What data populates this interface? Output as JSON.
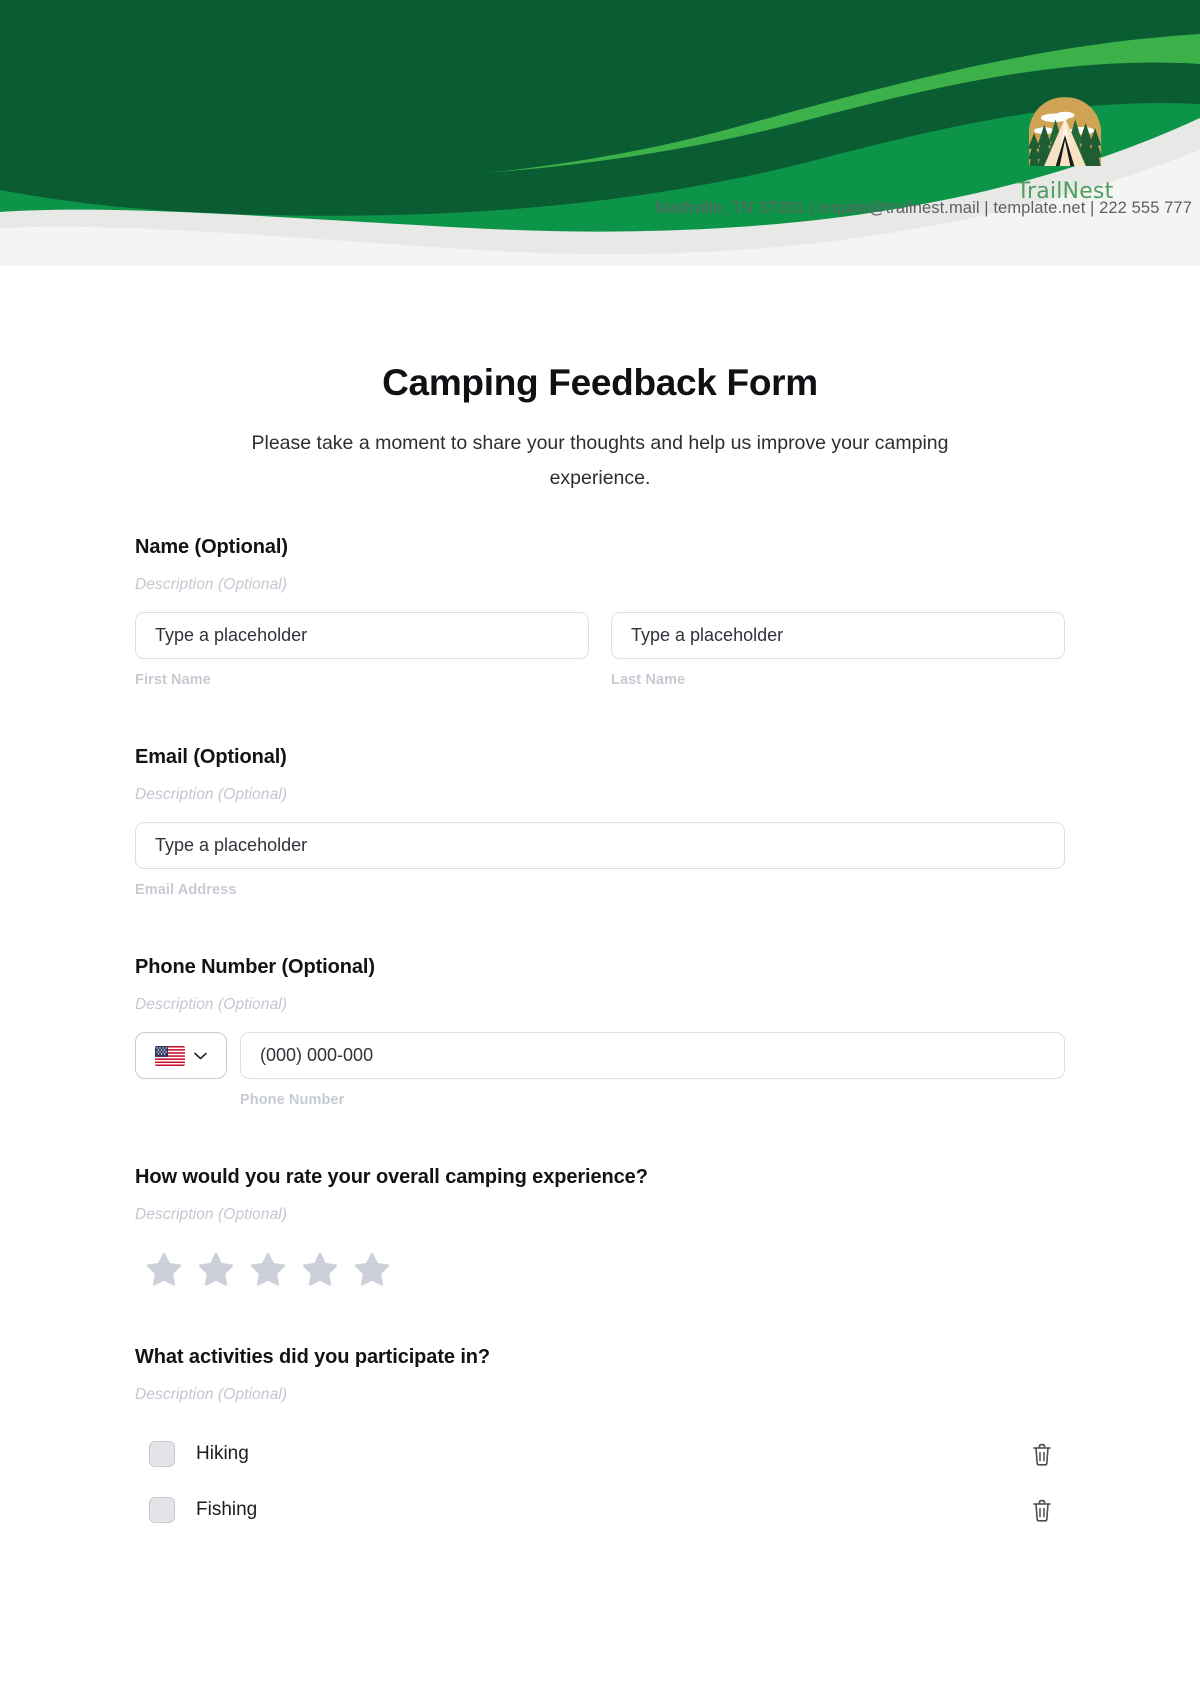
{
  "header": {
    "brand_name": "TrailNest",
    "contact_line": "Nashville, TN 37201 | inquire@trailnest.mail | template.net | 222 555 777",
    "logo_icon": "camping-tent-forest-logo",
    "colors": {
      "dark_green": "#0a5c33",
      "mid_green": "#0c9549",
      "light_green": "#3cb14a",
      "backdrop": "#f4f4f2",
      "brand_text": "#4d9e5f",
      "logo_sun": "#cfa455",
      "logo_tree": "#1e5c33",
      "logo_tent": "#f2dcc0"
    }
  },
  "form": {
    "title": "Camping Feedback Form",
    "subtitle": "Please take a moment to share your thoughts and help us improve your camping experience.",
    "name": {
      "label": "Name  (Optional)",
      "description": "Description (Optional)",
      "first": {
        "placeholder": "Type a placeholder",
        "sub_label": "First Name",
        "value": ""
      },
      "last": {
        "placeholder": "Type a placeholder",
        "sub_label": "Last Name",
        "value": ""
      }
    },
    "email": {
      "label": "Email  (Optional)",
      "description": "Description (Optional)",
      "placeholder": "Type a placeholder",
      "sub_label": "Email Address",
      "value": ""
    },
    "phone": {
      "label": "Phone Number  (Optional)",
      "description": "Description (Optional)",
      "country_flag": "us-flag-icon",
      "dropdown_icon": "chevron-down-icon",
      "placeholder": "(000) 000-000",
      "sub_label": "Phone Number",
      "value": ""
    },
    "rating": {
      "label": "How would you rate your overall camping experience?",
      "description": "Description (Optional)",
      "star_icon": "star-icon",
      "max": 5,
      "selected": 0,
      "star_color": "#ccd1d9"
    },
    "activities": {
      "label": "What activities did you participate in?",
      "description": "Description (Optional)",
      "delete_icon": "trash-icon",
      "options": [
        {
          "label": "Hiking",
          "checked": false
        },
        {
          "label": "Fishing",
          "checked": false
        }
      ]
    }
  }
}
